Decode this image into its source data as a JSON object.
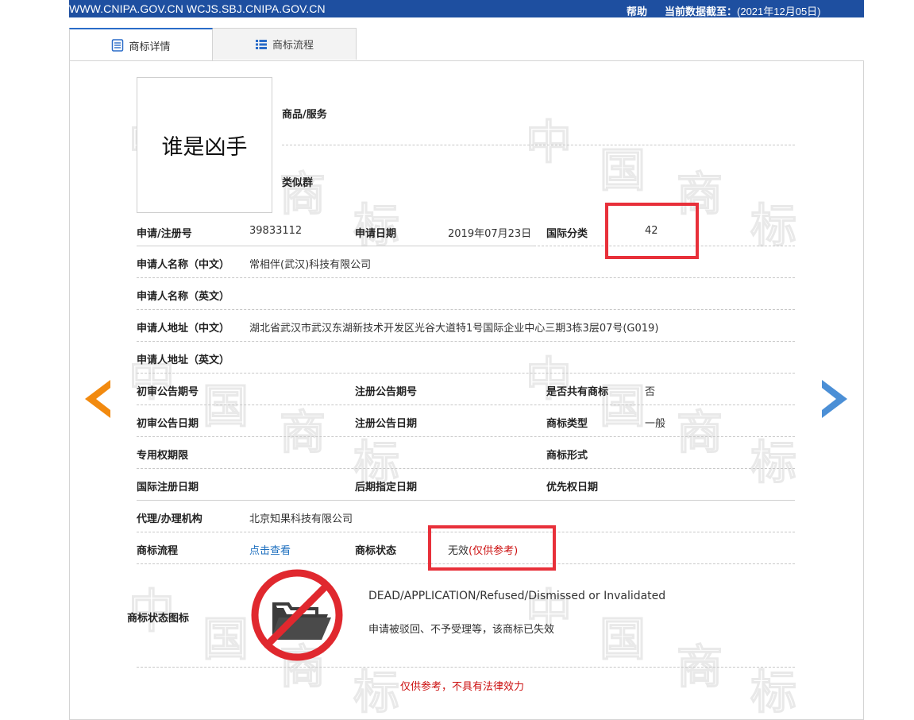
{
  "topbar": {
    "sites": "WWW.CNIPA.GOV.CN WCJS.SBJ.CNIPA.GOV.CN",
    "help": "帮助",
    "as_of_label": "当前数据截至：",
    "as_of_value": "(2021年12月05日)"
  },
  "tabs": [
    {
      "label": "商标详情",
      "active": true
    },
    {
      "label": "商标流程",
      "active": false
    }
  ],
  "watermark": [
    "中",
    "国",
    "商",
    "标"
  ],
  "trademark": {
    "image_text": "谁是凶手",
    "goods_services_label": "商品/服务",
    "similar_group_label": "类似群"
  },
  "fields": {
    "reg_no_label": "申请/注册号",
    "reg_no": "39833112",
    "apply_date_label": "申请日期",
    "apply_date": "2019年07月23日",
    "intl_class_label": "国际分类",
    "intl_class": "42",
    "applicant_cn_label": "申请人名称（中文）",
    "applicant_cn": "常相伴(武汉)科技有限公司",
    "applicant_en_label": "申请人名称（英文）",
    "address_cn_label": "申请人地址（中文）",
    "address_cn": "湖北省武汉市武汉东湖新技术开发区光谷大道特1号国际企业中心三期3栋3层07号(G019)",
    "address_en_label": "申请人地址（英文）",
    "prelim_no_label": "初审公告期号",
    "reg_pub_no_label": "注册公告期号",
    "shared_label": "是否共有商标",
    "shared": "否",
    "prelim_date_label": "初审公告日期",
    "reg_pub_date_label": "注册公告日期",
    "tm_type_label": "商标类型",
    "tm_type": "一般",
    "exclusive_label": "专用权期限",
    "tm_form_label": "商标形式",
    "intl_reg_date_label": "国际注册日期",
    "later_date_label": "后期指定日期",
    "priority_date_label": "优先权日期",
    "agent_label": "代理/办理机构",
    "agent": "北京知果科技有限公司",
    "flow_label": "商标流程",
    "flow_link": "点击查看",
    "status_label": "商标状态",
    "status_value": "无效",
    "status_note": "(仅供参考)",
    "status_icon_label": "商标状态图标"
  },
  "status_info": {
    "en": "DEAD/APPLICATION/Refused/Dismissed or Invalidated",
    "cn": "申请被驳回、不予受理等，该商标已失效"
  },
  "disclaimer": "仅供参考，不具有法律效力",
  "colors": {
    "topbar": "#1e4fa0",
    "highlight": "#e8303a",
    "prev_arrow": "#f28a0f",
    "next_arrow": "#4b8fd6",
    "link": "#1d6fbf"
  }
}
